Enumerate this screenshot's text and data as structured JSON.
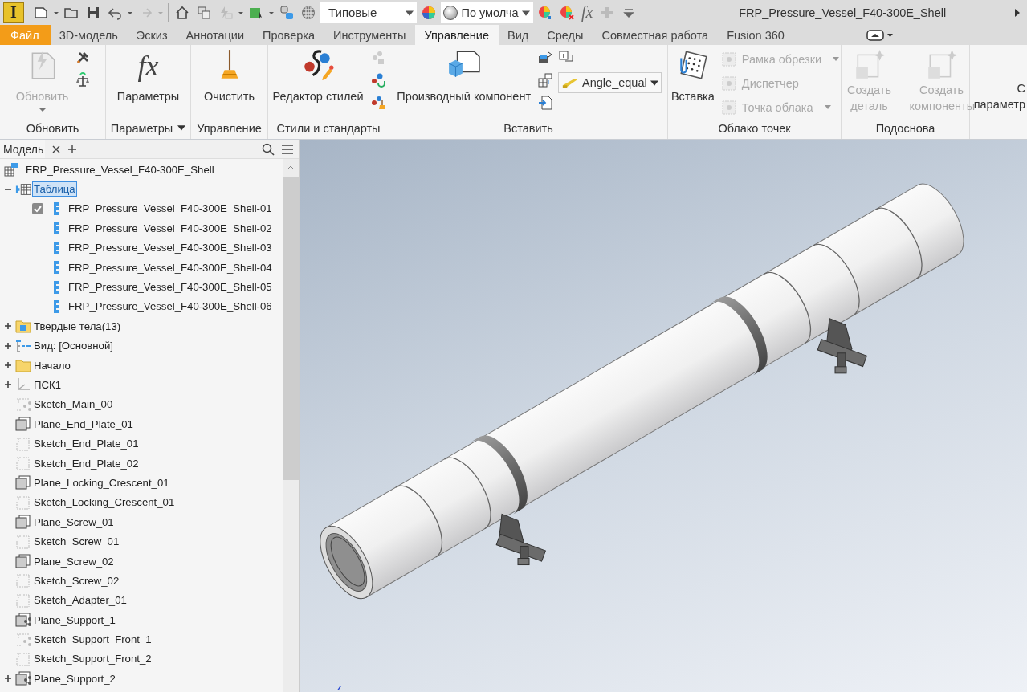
{
  "quick_access": {
    "app_logo": "I",
    "style_dropdown": "Типовые",
    "appearance_dropdown": "По умолча",
    "formula_symbol": "fx",
    "document_title": "FRP_Pressure_Vessel_F40-300E_Shell"
  },
  "tabs": [
    {
      "label": "Файл",
      "kind": "file",
      "selected": false
    },
    {
      "label": "3D-модель",
      "kind": "normal",
      "selected": false
    },
    {
      "label": "Эскиз",
      "kind": "normal",
      "selected": false
    },
    {
      "label": "Аннотации",
      "kind": "normal",
      "selected": false
    },
    {
      "label": "Проверка",
      "kind": "normal",
      "selected": false
    },
    {
      "label": "Инструменты",
      "kind": "normal",
      "selected": false
    },
    {
      "label": "Управление",
      "kind": "normal",
      "selected": true
    },
    {
      "label": "Вид",
      "kind": "normal",
      "selected": false
    },
    {
      "label": "Среды",
      "kind": "normal",
      "selected": false
    },
    {
      "label": "Совместная работа",
      "kind": "normal",
      "selected": false
    },
    {
      "label": "Fusion 360",
      "kind": "normal",
      "selected": false
    }
  ],
  "ribbon": {
    "panels": [
      {
        "title": "Обновить",
        "buttons": [
          {
            "label": "Обновить",
            "disabled": true
          }
        ]
      },
      {
        "title": "Параметры",
        "has_menu": true,
        "icon_text": "fx",
        "buttons": [
          {
            "label": "Параметры",
            "disabled": false
          }
        ]
      },
      {
        "title": "Управление",
        "buttons": [
          {
            "label": "Очистить",
            "disabled": false
          }
        ]
      },
      {
        "title": "Стили и стандарты",
        "buttons": [
          {
            "label": "Редактор стилей",
            "disabled": false
          }
        ]
      },
      {
        "title": "Вставить",
        "buttons": [
          {
            "label": "Производный компонент",
            "disabled": false
          }
        ],
        "dropdown": "Angle_equal"
      },
      {
        "title": "Облако точек",
        "buttons": [
          {
            "label": "Вставка",
            "disabled": false
          },
          {
            "label": "Рамка обрезки",
            "disabled": true
          },
          {
            "label": "Диспетчер",
            "disabled": true
          },
          {
            "label": "Точка облака",
            "disabled": true
          }
        ]
      },
      {
        "title": "Подоснова",
        "buttons": [
          {
            "label": "Создать деталь",
            "disabled": true
          },
          {
            "label": "Создать компоненты",
            "disabled": true
          }
        ]
      },
      {
        "buttons": [
          {
            "label_lines": [
              "С",
              "параметр"
            ],
            "disabled": false
          }
        ]
      }
    ]
  },
  "browser": {
    "tab_label": "Модель",
    "root": "FRP_Pressure_Vessel_F40-300E_Shell",
    "items": [
      {
        "label": "Таблица",
        "kind": "table",
        "expanded": true,
        "selected": true,
        "children": [
          {
            "label": "FRP_Pressure_Vessel_F40-300E_Shell-01",
            "kind": "part",
            "checked": true,
            "selected": false
          },
          {
            "label": "FRP_Pressure_Vessel_F40-300E_Shell-02",
            "kind": "part",
            "checked": false,
            "selected": false
          },
          {
            "label": "FRP_Pressure_Vessel_F40-300E_Shell-03",
            "kind": "part",
            "checked": false,
            "selected": false
          },
          {
            "label": "FRP_Pressure_Vessel_F40-300E_Shell-04",
            "kind": "part",
            "checked": false,
            "selected": false
          },
          {
            "label": "FRP_Pressure_Vessel_F40-300E_Shell-05",
            "kind": "part",
            "checked": false,
            "selected": false
          },
          {
            "label": "FRP_Pressure_Vessel_F40-300E_Shell-06",
            "kind": "part",
            "checked": false,
            "selected": false
          }
        ]
      },
      {
        "label": "Твердые тела(13)",
        "kind": "bodies",
        "expanded": false,
        "selected": false
      },
      {
        "label": "Вид: [Основной]",
        "kind": "view",
        "expanded": false,
        "selected": false
      },
      {
        "label": "Начало",
        "kind": "folder",
        "expanded": false,
        "selected": false
      },
      {
        "label": "ПСК1",
        "kind": "ucs",
        "expanded": false,
        "selected": false
      },
      {
        "label": "Sketch_Main_00",
        "kind": "sketch-shared",
        "selected": false
      },
      {
        "label": "Plane_End_Plate_01",
        "kind": "plane",
        "selected": false
      },
      {
        "label": "Sketch_End_Plate_01",
        "kind": "sketch",
        "selected": false
      },
      {
        "label": "Sketch_End_Plate_02",
        "kind": "sketch",
        "selected": false
      },
      {
        "label": "Plane_Locking_Crescent_01",
        "kind": "plane",
        "selected": false
      },
      {
        "label": "Sketch_Locking_Crescent_01",
        "kind": "sketch",
        "selected": false
      },
      {
        "label": "Plane_Screw_01",
        "kind": "plane",
        "selected": false
      },
      {
        "label": "Sketch_Screw_01",
        "kind": "sketch",
        "selected": false
      },
      {
        "label": "Plane_Screw_02",
        "kind": "plane",
        "selected": false
      },
      {
        "label": "Sketch_Screw_02",
        "kind": "sketch",
        "selected": false
      },
      {
        "label": "Sketch_Adapter_01",
        "kind": "sketch",
        "selected": false
      },
      {
        "label": "Plane_Support_1",
        "kind": "plane-shared",
        "selected": false
      },
      {
        "label": "Sketch_Support_Front_1",
        "kind": "sketch-shared",
        "selected": false
      },
      {
        "label": "Sketch_Support_Front_2",
        "kind": "sketch",
        "selected": false
      },
      {
        "label": "Plane_Support_2",
        "kind": "plane-shared",
        "expanded": false,
        "selected": false
      }
    ]
  },
  "viewport": {
    "axis_label": "z"
  }
}
